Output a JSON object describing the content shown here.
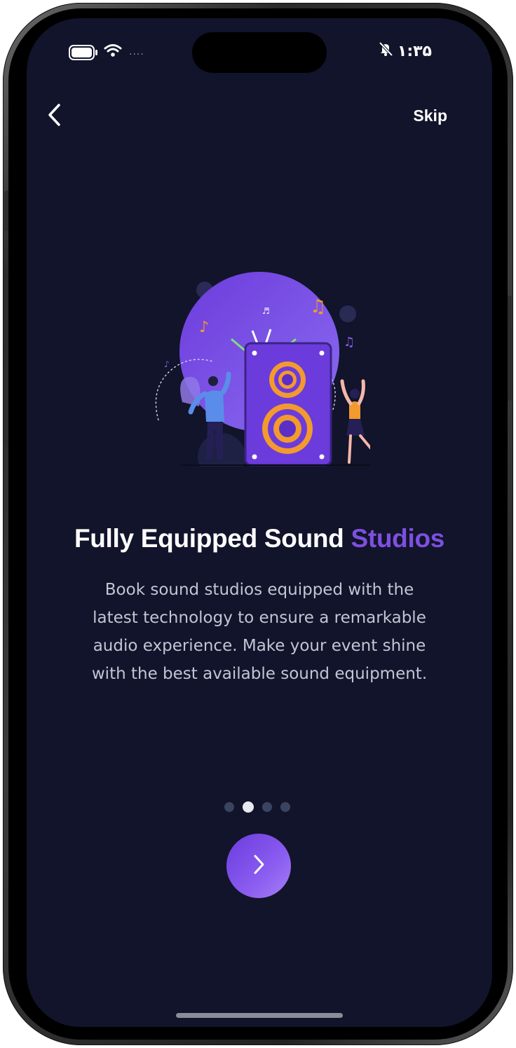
{
  "status_bar": {
    "time": "۱:۳۵",
    "signal_dots": "....",
    "icons": [
      "battery-icon",
      "wifi-icon",
      "silent-bell-icon"
    ]
  },
  "nav": {
    "back_icon": "chevron-left-icon",
    "skip_label": "Skip"
  },
  "onboarding": {
    "title_main": "Fully Equipped Sound ",
    "title_accent": "Studios",
    "description": "Book sound studios equipped with the latest technology to ensure a remarkable audio experience. Make your event shine with the best available sound equipment.",
    "page_count": 4,
    "active_page": 2,
    "next_icon": "chevron-right-icon"
  },
  "colors": {
    "background": "#11142a",
    "accent": "#7e4fe0",
    "text_primary": "#ffffff",
    "text_secondary": "#c3c5d4",
    "dot_inactive": "#3a4460",
    "dot_active": "#e9e9f0"
  }
}
